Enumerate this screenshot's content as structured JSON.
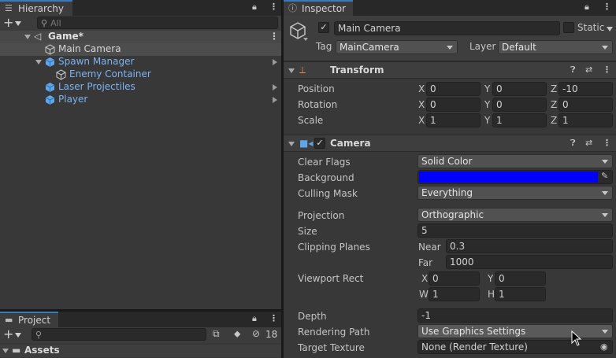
{
  "hierarchy": {
    "tab_label": "Hierarchy",
    "search_placeholder": "All",
    "scene_name": "Game*",
    "items": [
      {
        "label": "Main Camera"
      },
      {
        "label": "Spawn Manager"
      },
      {
        "label": "Enemy Container"
      },
      {
        "label": "Laser Projectiles"
      },
      {
        "label": "Player"
      }
    ]
  },
  "project": {
    "tab_label": "Project",
    "hidden_count": "18",
    "assets_label": "Assets"
  },
  "inspector": {
    "tab_label": "Inspector",
    "object_name": "Main Camera",
    "static_label": "Static",
    "tag_label": "Tag",
    "tag_value": "MainCamera",
    "layer_label": "Layer",
    "layer_value": "Default",
    "transform": {
      "title": "Transform",
      "rows": [
        {
          "label": "Position",
          "x": "0",
          "y": "0",
          "z": "-10"
        },
        {
          "label": "Rotation",
          "x": "0",
          "y": "0",
          "z": "0"
        },
        {
          "label": "Scale",
          "x": "1",
          "y": "1",
          "z": "1"
        }
      ],
      "axis_x": "X",
      "axis_y": "Y",
      "axis_z": "Z"
    },
    "camera": {
      "title": "Camera",
      "clear_flags_label": "Clear Flags",
      "clear_flags_value": "Solid Color",
      "background_label": "Background",
      "background_color": "#0000ff",
      "culling_mask_label": "Culling Mask",
      "culling_mask_value": "Everything",
      "projection_label": "Projection",
      "projection_value": "Orthographic",
      "size_label": "Size",
      "size_value": "5",
      "clipping_label": "Clipping Planes",
      "near_label": "Near",
      "near_value": "0.3",
      "far_label": "Far",
      "far_value": "1000",
      "viewport_label": "Viewport Rect",
      "vx_label": "X",
      "vx_value": "0",
      "vy_label": "Y",
      "vy_value": "0",
      "vw_label": "W",
      "vw_value": "1",
      "vh_label": "H",
      "vh_value": "1",
      "depth_label": "Depth",
      "depth_value": "-1",
      "rendering_path_label": "Rendering Path",
      "rendering_path_value": "Use Graphics Settings",
      "target_texture_label": "Target Texture",
      "target_texture_value": "None (Render Texture)"
    }
  },
  "colors": {
    "accent": "#3a79bb",
    "prefab_blue": "#7cb3f0",
    "panel": "#383838"
  }
}
